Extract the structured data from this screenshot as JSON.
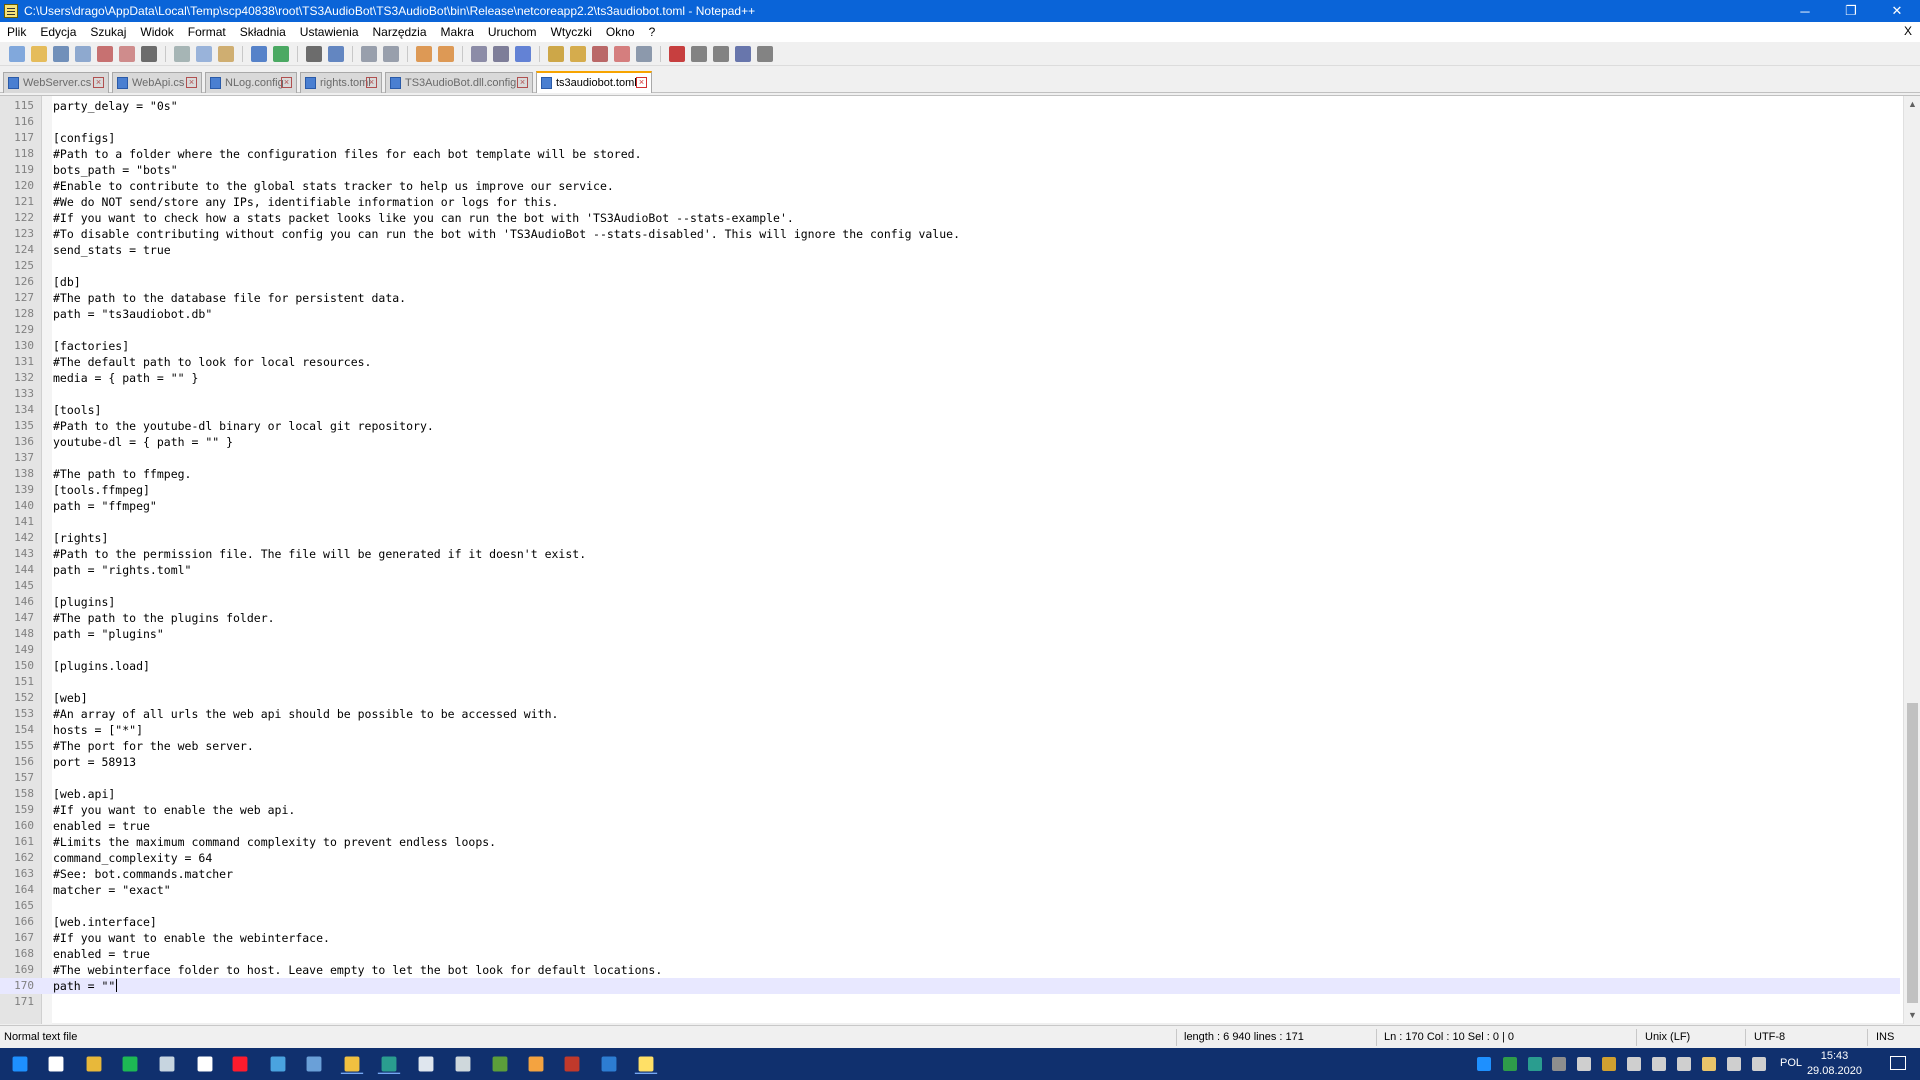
{
  "window": {
    "title": "C:\\Users\\drago\\AppData\\Local\\Temp\\scp40838\\root\\TS3AudioBot\\TS3AudioBot\\bin\\Release\\netcoreapp2.2\\ts3audiobot.toml - Notepad++",
    "minimize": "─",
    "maximize": "❐",
    "close": "✕"
  },
  "menu": {
    "items": [
      "Plik",
      "Edycja",
      "Szukaj",
      "Widok",
      "Format",
      "Składnia",
      "Ustawienia",
      "Narzędzia",
      "Makra",
      "Uruchom",
      "Wtyczki",
      "Okno",
      "?"
    ],
    "close_doc": "X"
  },
  "toolbar_icons": [
    "new-file-icon",
    "open-file-icon",
    "save-icon",
    "save-all-icon",
    "close-icon",
    "close-all-icon",
    "print-icon",
    "cut-icon",
    "copy-icon",
    "paste-icon",
    "undo-icon",
    "redo-icon",
    "find-icon",
    "replace-icon",
    "zoom-in-icon",
    "zoom-out-icon",
    "sync-vertical-icon",
    "sync-horizontal-icon",
    "word-wrap-icon",
    "show-all-chars-icon",
    "indent-guide-icon",
    "udl-icon",
    "doc-map-icon",
    "function-list-icon",
    "folder-workspace-icon",
    "monitoring-icon",
    "record-macro-icon",
    "stop-macro-icon",
    "play-macro-icon",
    "run-macro-multiple-icon",
    "save-macro-icon"
  ],
  "tabs": [
    {
      "label": "WebServer.cs",
      "active": false
    },
    {
      "label": "WebApi.cs",
      "active": false
    },
    {
      "label": "NLog.config",
      "active": false
    },
    {
      "label": "rights.toml",
      "active": false
    },
    {
      "label": "TS3AudioBot.dll.config",
      "active": false
    },
    {
      "label": "ts3audiobot.toml",
      "active": true
    }
  ],
  "editor": {
    "current_line": 170,
    "lines": [
      {
        "n": "115",
        "text": "party_delay = \"0s\""
      },
      {
        "n": "116",
        "text": ""
      },
      {
        "n": "117",
        "text": "[configs]"
      },
      {
        "n": "118",
        "text": "#Path to a folder where the configuration files for each bot template will be stored."
      },
      {
        "n": "119",
        "text": "bots_path = \"bots\""
      },
      {
        "n": "120",
        "text": "#Enable to contribute to the global stats tracker to help us improve our service."
      },
      {
        "n": "121",
        "text": "#We do NOT send/store any IPs, identifiable information or logs for this."
      },
      {
        "n": "122",
        "text": "#If you want to check how a stats packet looks like you can run the bot with 'TS3AudioBot --stats-example'."
      },
      {
        "n": "123",
        "text": "#To disable contributing without config you can run the bot with 'TS3AudioBot --stats-disabled'. This will ignore the config value."
      },
      {
        "n": "124",
        "text": "send_stats = true"
      },
      {
        "n": "125",
        "text": ""
      },
      {
        "n": "126",
        "text": "[db]"
      },
      {
        "n": "127",
        "text": "#The path to the database file for persistent data."
      },
      {
        "n": "128",
        "text": "path = \"ts3audiobot.db\""
      },
      {
        "n": "129",
        "text": ""
      },
      {
        "n": "130",
        "text": "[factories]"
      },
      {
        "n": "131",
        "text": "#The default path to look for local resources."
      },
      {
        "n": "132",
        "text": "media = { path = \"\" }"
      },
      {
        "n": "133",
        "text": ""
      },
      {
        "n": "134",
        "text": "[tools]"
      },
      {
        "n": "135",
        "text": "#Path to the youtube-dl binary or local git repository."
      },
      {
        "n": "136",
        "text": "youtube-dl = { path = \"\" }"
      },
      {
        "n": "137",
        "text": ""
      },
      {
        "n": "138",
        "text": "#The path to ffmpeg."
      },
      {
        "n": "139",
        "text": "[tools.ffmpeg]"
      },
      {
        "n": "140",
        "text": "path = \"ffmpeg\""
      },
      {
        "n": "141",
        "text": ""
      },
      {
        "n": "142",
        "text": "[rights]"
      },
      {
        "n": "143",
        "text": "#Path to the permission file. The file will be generated if it doesn't exist."
      },
      {
        "n": "144",
        "text": "path = \"rights.toml\""
      },
      {
        "n": "145",
        "text": ""
      },
      {
        "n": "146",
        "text": "[plugins]"
      },
      {
        "n": "147",
        "text": "#The path to the plugins folder."
      },
      {
        "n": "148",
        "text": "path = \"plugins\""
      },
      {
        "n": "149",
        "text": ""
      },
      {
        "n": "150",
        "text": "[plugins.load]"
      },
      {
        "n": "151",
        "text": ""
      },
      {
        "n": "152",
        "text": "[web]"
      },
      {
        "n": "153",
        "text": "#An array of all urls the web api should be possible to be accessed with."
      },
      {
        "n": "154",
        "text": "hosts = [\"*\"]"
      },
      {
        "n": "155",
        "text": "#The port for the web server."
      },
      {
        "n": "156",
        "text": "port = 58913"
      },
      {
        "n": "157",
        "text": ""
      },
      {
        "n": "158",
        "text": "[web.api]"
      },
      {
        "n": "159",
        "text": "#If you want to enable the web api."
      },
      {
        "n": "160",
        "text": "enabled = true"
      },
      {
        "n": "161",
        "text": "#Limits the maximum command complexity to prevent endless loops."
      },
      {
        "n": "162",
        "text": "command_complexity = 64"
      },
      {
        "n": "163",
        "text": "#See: bot.commands.matcher"
      },
      {
        "n": "164",
        "text": "matcher = \"exact\""
      },
      {
        "n": "165",
        "text": ""
      },
      {
        "n": "166",
        "text": "[web.interface]"
      },
      {
        "n": "167",
        "text": "#If you want to enable the webinterface."
      },
      {
        "n": "168",
        "text": "enabled = true"
      },
      {
        "n": "169",
        "text": "#The webinterface folder to host. Leave empty to let the bot look for default locations."
      },
      {
        "n": "170",
        "text": "path = \"\""
      },
      {
        "n": "171",
        "text": ""
      }
    ]
  },
  "status": {
    "file_type": "Normal text file",
    "length_lines": "length : 6 940    lines : 171",
    "position": "Ln : 170    Col : 10    Sel : 0 | 0",
    "eol": "Unix (LF)",
    "encoding": "UTF-8",
    "mode": "INS"
  },
  "taskbar": {
    "apps": [
      "windows-start-icon",
      "task-view-icon",
      "file-explorer-icon",
      "spotify-icon",
      "steam-icon",
      "app-icon",
      "opera-icon",
      "app-icon",
      "app-icon",
      "winscp-icon",
      "network-app-icon",
      "app-icon",
      "unity-icon",
      "box-app-icon",
      "app-icon",
      "app-icon",
      "app-icon",
      "notepadpp-icon"
    ],
    "lang": "POL",
    "time": "15:43",
    "date": "29.08.2020"
  },
  "colors": {
    "titlebar": "#0a64d8",
    "taskbar": "#10306e",
    "current_line": "#e8e8ff",
    "active_tab_accent": "#f7a400"
  }
}
